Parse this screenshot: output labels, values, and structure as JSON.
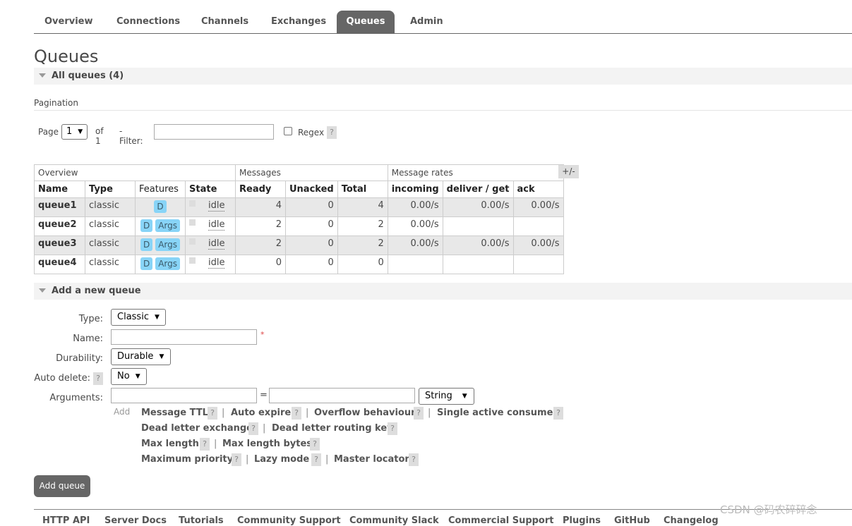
{
  "nav": {
    "tabs": [
      "Overview",
      "Connections",
      "Channels",
      "Exchanges",
      "Queues",
      "Admin"
    ],
    "active": "Queues"
  },
  "page_title": "Queues",
  "all_queues_header": "All queues (4)",
  "pagination": {
    "label": "Pagination",
    "page_label": "Page",
    "page_value": "1",
    "of_label": "of 1",
    "filter_label": "- Filter:",
    "filter_value": "",
    "regex_label": "Regex",
    "help": "?"
  },
  "table": {
    "groups": [
      "Overview",
      "Messages",
      "Message rates"
    ],
    "columns": [
      "Name",
      "Type",
      "Features",
      "State",
      "Ready",
      "Unacked",
      "Total",
      "incoming",
      "deliver / get",
      "ack"
    ],
    "plus_minus": "+/-",
    "rows": [
      {
        "name": "queue1",
        "type": "classic",
        "features": [
          "D"
        ],
        "state": "idle",
        "ready": "4",
        "unacked": "0",
        "total": "4",
        "incoming": "0.00/s",
        "deliver_get": "0.00/s",
        "ack": "0.00/s"
      },
      {
        "name": "queue2",
        "type": "classic",
        "features": [
          "D",
          "Args"
        ],
        "state": "idle",
        "ready": "2",
        "unacked": "0",
        "total": "2",
        "incoming": "0.00/s",
        "deliver_get": "",
        "ack": ""
      },
      {
        "name": "queue3",
        "type": "classic",
        "features": [
          "D",
          "Args"
        ],
        "state": "idle",
        "ready": "2",
        "unacked": "0",
        "total": "2",
        "incoming": "0.00/s",
        "deliver_get": "0.00/s",
        "ack": "0.00/s"
      },
      {
        "name": "queue4",
        "type": "classic",
        "features": [
          "D",
          "Args"
        ],
        "state": "idle",
        "ready": "0",
        "unacked": "0",
        "total": "0",
        "incoming": "",
        "deliver_get": "",
        "ack": ""
      }
    ]
  },
  "add_queue": {
    "header": "Add a new queue",
    "type_label": "Type:",
    "type_value": "Classic",
    "name_label": "Name:",
    "name_value": "",
    "required_mark": "*",
    "durability_label": "Durability:",
    "durability_value": "Durable",
    "auto_delete_label": "Auto delete:",
    "auto_delete_value": "No",
    "arguments_label": "Arguments:",
    "equals": "=",
    "arg_type_value": "String",
    "add_label": "Add",
    "arg_links": [
      [
        "Message TTL",
        "Auto expire",
        "Overflow behaviour",
        "Single active consumer"
      ],
      [
        "Dead letter exchange",
        "Dead letter routing key"
      ],
      [
        "Max length",
        "Max length bytes"
      ],
      [
        "Maximum priority",
        "Lazy mode",
        "Master locator"
      ]
    ],
    "separator": "|",
    "submit_label": "Add queue"
  },
  "footer": [
    "HTTP API",
    "Server Docs",
    "Tutorials",
    "Community Support",
    "Community Slack",
    "Commercial Support",
    "Plugins",
    "GitHub",
    "Changelog"
  ],
  "watermark": "CSDN @码农碎碎念"
}
